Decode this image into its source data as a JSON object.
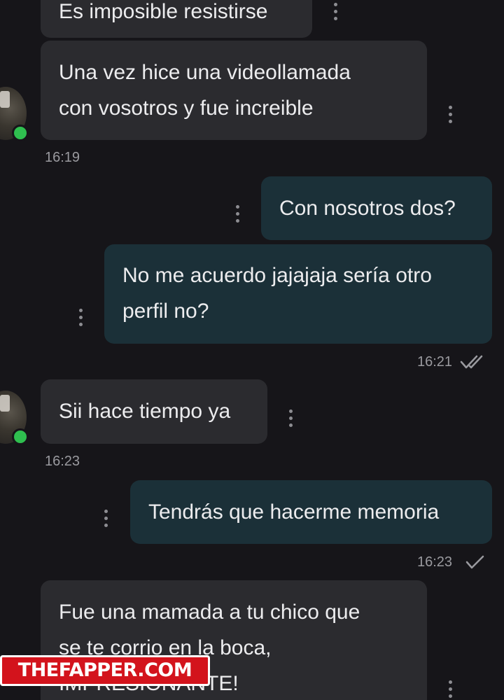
{
  "messages": [
    {
      "direction": "in",
      "lines": [
        "Es imposible resistirse"
      ]
    },
    {
      "direction": "in",
      "lines": [
        "Una vez hice una videollamada",
        "con vosotros y fue increible"
      ],
      "time": "16:19"
    },
    {
      "direction": "out",
      "lines": [
        "Con nosotros dos?"
      ]
    },
    {
      "direction": "out",
      "lines": [
        "No me acuerdo jajajaja sería otro",
        "perfil no?"
      ],
      "time": "16:21",
      "status": "read"
    },
    {
      "direction": "in",
      "lines": [
        "Sii hace tiempo ya"
      ],
      "time": "16:23"
    },
    {
      "direction": "out",
      "lines": [
        "Tendrás que hacerme memoria"
      ],
      "time": "16:23",
      "status": "sent"
    },
    {
      "direction": "in",
      "lines": [
        "Fue una mamada a tu chico que",
        "se te corrio en la boca,",
        "IMPRESIONANTE!"
      ]
    }
  ],
  "watermark": "THEFAPPER.COM",
  "icons": {
    "menu": "vertical-ellipsis-icon",
    "read": "double-check-icon",
    "sent": "single-check-icon"
  },
  "colors": {
    "background": "#161519",
    "incoming_bubble": "#2b2b2f",
    "outgoing_bubble": "#1b3038",
    "online": "#2fbf4f",
    "watermark": "#d3131c"
  }
}
